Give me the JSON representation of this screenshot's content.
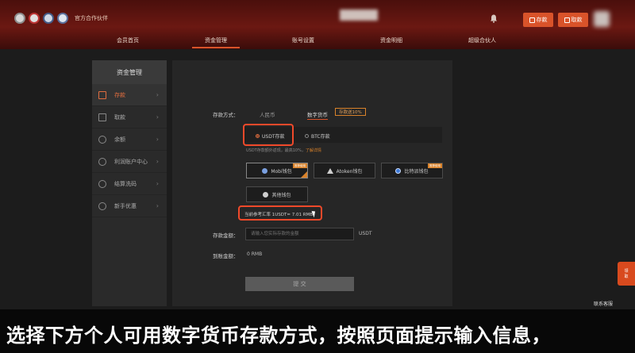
{
  "header": {
    "brand_text": "官方合作伙伴",
    "deposit_label": "存款",
    "withdraw_label": "取款"
  },
  "nav": {
    "items": [
      "会员首页",
      "资金管理",
      "账号设置",
      "资金明细",
      "超级合伙人"
    ]
  },
  "sidebar": {
    "title": "资金管理",
    "items": [
      {
        "label": "存款",
        "active": true
      },
      {
        "label": "取款"
      },
      {
        "label": "余额"
      },
      {
        "label": "利润账户中心"
      },
      {
        "label": "结算洗码"
      },
      {
        "label": "新手优惠"
      }
    ]
  },
  "deposit": {
    "method_label": "存款方式：",
    "tab_rmb": "人民币",
    "tab_crypto": "数字货币",
    "promo_tag": "存款送10%",
    "opt_usdt": "USDT存款",
    "opt_btc": "BTC存款",
    "note_text": "USDT存款额外返现，最高10%，",
    "note_link": "了解详情",
    "wallets": [
      {
        "label": "Mobi钱包"
      },
      {
        "label": "Atoken钱包"
      },
      {
        "label": "比特派钱包"
      },
      {
        "label": "其他钱包"
      }
    ],
    "corner_tag": "推荐使用",
    "rate_text": "当前参考汇率 1USDT= 7.01 RMB",
    "amount_label": "存款金额：",
    "amount_placeholder": "请输入您实际存款的金额",
    "amount_unit": "USDT",
    "arrive_label": "到账金额：",
    "arrive_value": "0  RMB",
    "submit_label": "提 交"
  },
  "side_widgets": {
    "gift_line1": "领",
    "gift_line2": "取",
    "contact": "联系客服"
  },
  "caption": {
    "text": "选择下方个人可用数字货币存款方式，按照页面提示输入信息，"
  }
}
